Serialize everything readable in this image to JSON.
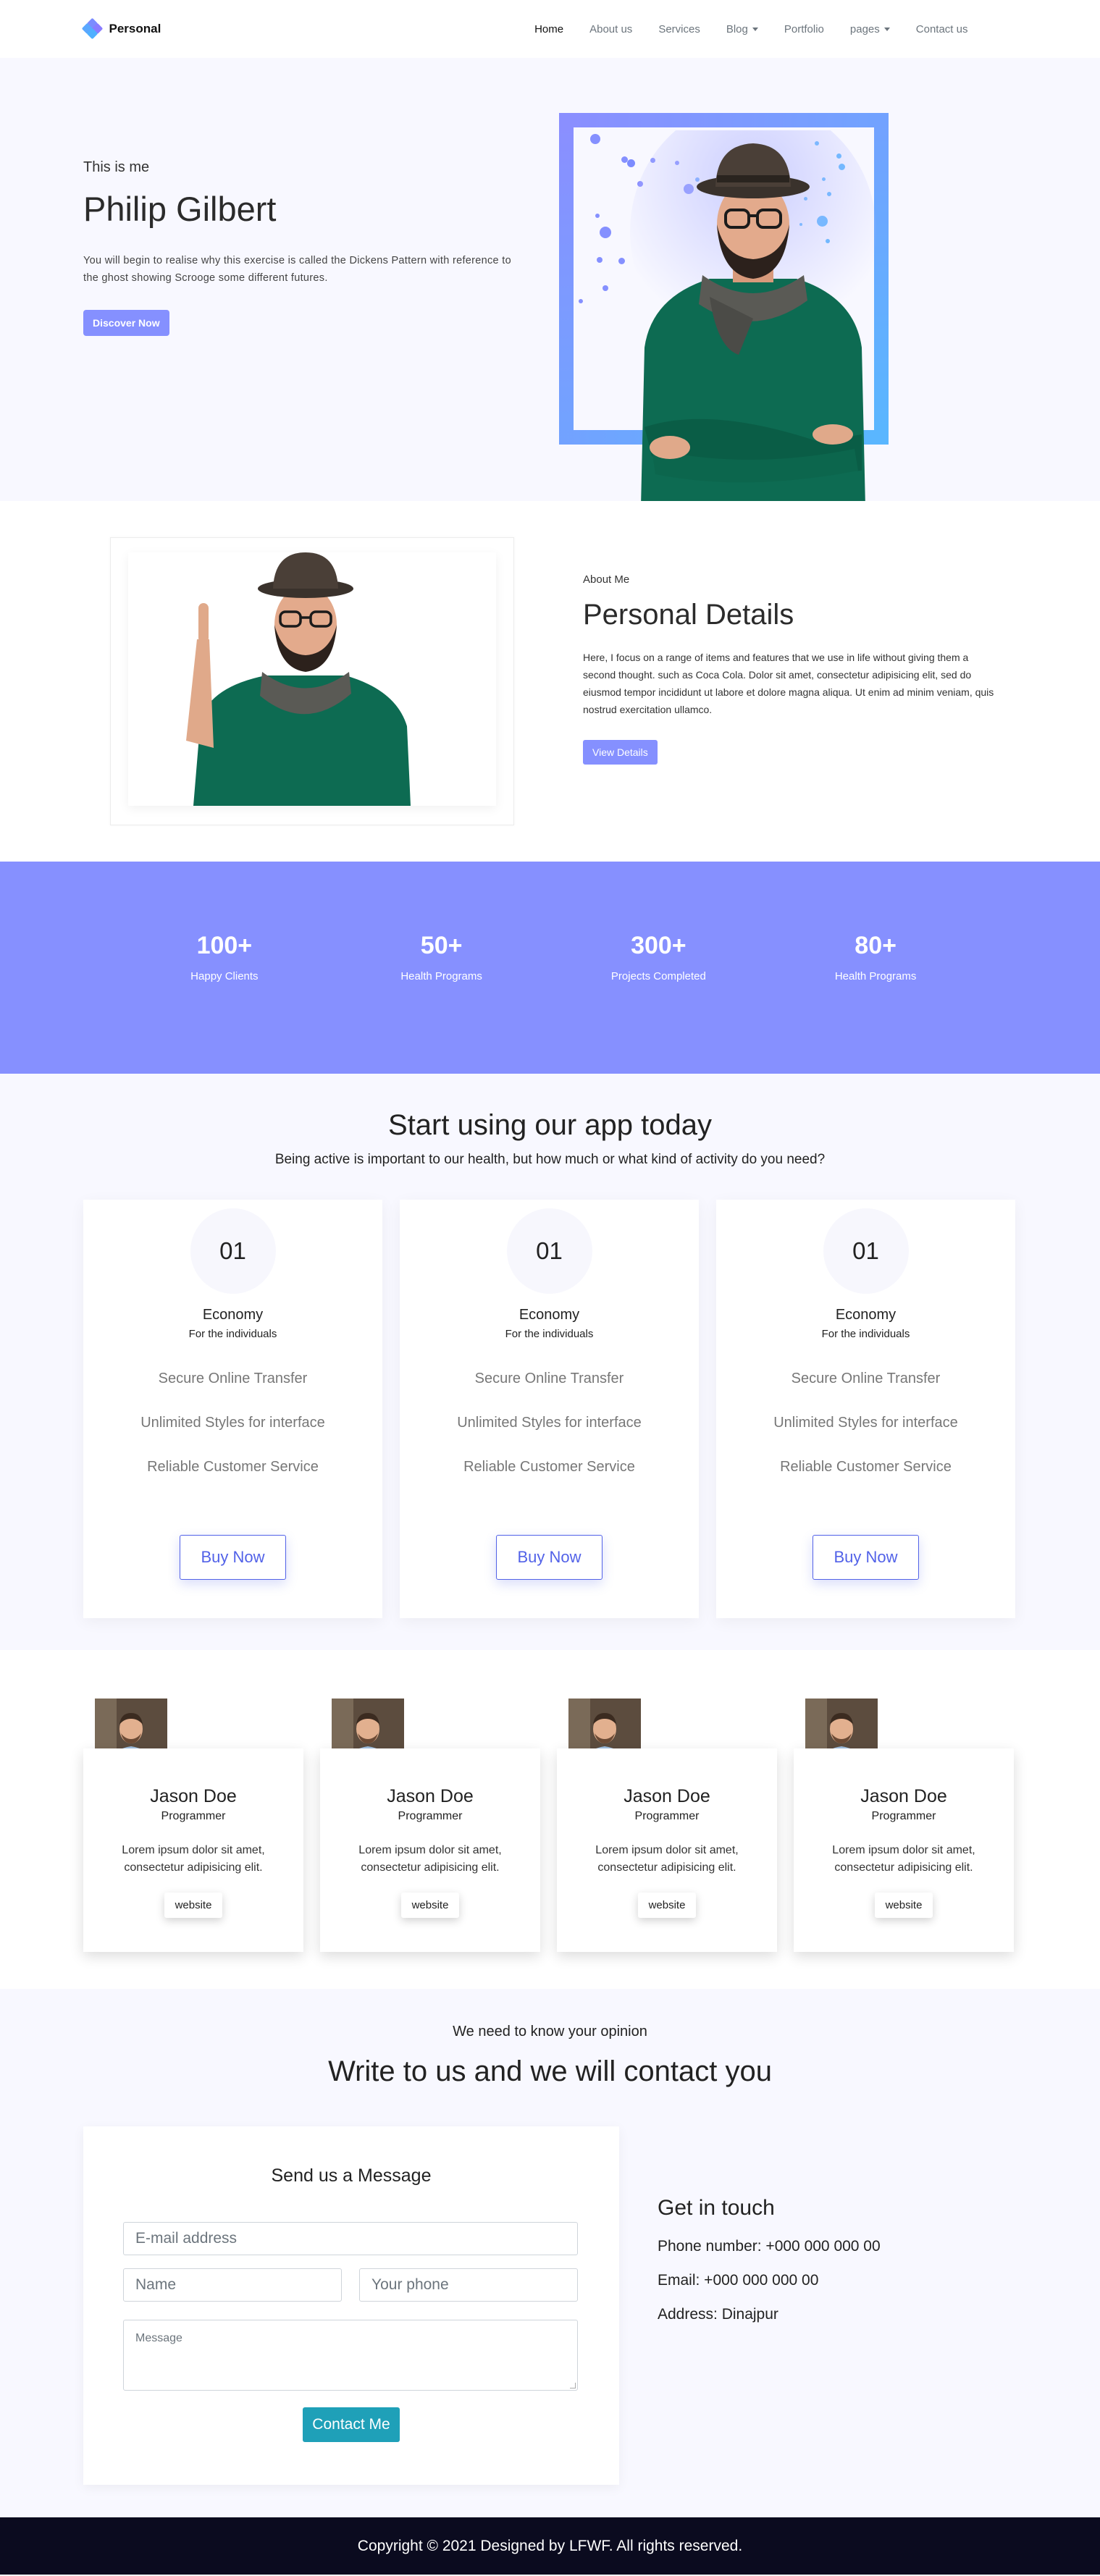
{
  "nav": {
    "brand": "Personal",
    "links": [
      {
        "label": "Home",
        "active": true,
        "dropdown": false
      },
      {
        "label": "About us",
        "active": false,
        "dropdown": false
      },
      {
        "label": "Services",
        "active": false,
        "dropdown": false
      },
      {
        "label": "Blog",
        "active": false,
        "dropdown": true
      },
      {
        "label": "Portfolio",
        "active": false,
        "dropdown": false
      },
      {
        "label": "pages",
        "active": false,
        "dropdown": true
      },
      {
        "label": "Contact us",
        "active": false,
        "dropdown": false
      }
    ]
  },
  "hero": {
    "kicker": "This is me",
    "title": "Philip Gilbert",
    "text": "You will begin to realise why this exercise is called the Dickens Pattern with reference to the ghost showing Scrooge some different futures.",
    "button": "Discover Now"
  },
  "about": {
    "kicker": "About Me",
    "title": "Personal Details",
    "text": "Here, I focus on a range of items and features that we use in life without giving them a second thought. such as Coca Cola. Dolor sit amet, consectetur adipisicing elit, sed do eiusmod tempor incididunt ut labore et dolore magna aliqua. Ut enim ad minim veniam, quis nostrud exercitation ullamco.",
    "button": "View Details"
  },
  "stats": [
    {
      "number": "100+",
      "label": "Happy Clients"
    },
    {
      "number": "50+",
      "label": "Health Programs"
    },
    {
      "number": "300+",
      "label": "Projects Completed"
    },
    {
      "number": "80+",
      "label": "Health Programs"
    }
  ],
  "pricing": {
    "title": "Start using our app today",
    "subtitle": "Being active is important to our health, but how much or what kind of activity do you need?",
    "plans": [
      {
        "number": "01",
        "name": "Economy",
        "for": "For the individuals",
        "features": [
          "Secure Online Transfer",
          "Unlimited Styles for interface",
          "Reliable Customer Service"
        ],
        "button": "Buy Now"
      },
      {
        "number": "01",
        "name": "Economy",
        "for": "For the individuals",
        "features": [
          "Secure Online Transfer",
          "Unlimited Styles for interface",
          "Reliable Customer Service"
        ],
        "button": "Buy Now"
      },
      {
        "number": "01",
        "name": "Economy",
        "for": "For the individuals",
        "features": [
          "Secure Online Transfer",
          "Unlimited Styles for interface",
          "Reliable Customer Service"
        ],
        "button": "Buy Now"
      }
    ]
  },
  "team": [
    {
      "name": "Jason Doe",
      "role": "Programmer",
      "text": "Lorem ipsum dolor sit amet, consectetur adipisicing elit.",
      "button": "website"
    },
    {
      "name": "Jason Doe",
      "role": "Programmer",
      "text": "Lorem ipsum dolor sit amet, consectetur adipisicing elit.",
      "button": "website"
    },
    {
      "name": "Jason Doe",
      "role": "Programmer",
      "text": "Lorem ipsum dolor sit amet, consectetur adipisicing elit.",
      "button": "website"
    },
    {
      "name": "Jason Doe",
      "role": "Programmer",
      "text": "Lorem ipsum dolor sit amet, consectetur adipisicing elit.",
      "button": "website"
    }
  ],
  "contact": {
    "kicker": "We need to know your opinion",
    "title": "Write to us and we will contact you",
    "form_title": "Send us a Message",
    "email_placeholder": "E-mail address",
    "name_placeholder": "Name",
    "phone_placeholder": "Your phone",
    "message_placeholder": "Message",
    "button": "Contact Me",
    "git_title": "Get in touch",
    "phone": "Phone number: +000 000 000 00",
    "email": "Email: +000 000 000 00",
    "address": "Address: Dinajpur"
  },
  "footer": {
    "text": "Copyright © 2021 Designed by LFWF. All rights reserved."
  },
  "colors": {
    "accent": "#8690ff",
    "contact_button": "#1fa0b8",
    "footer_bg": "#0b0b1f"
  }
}
